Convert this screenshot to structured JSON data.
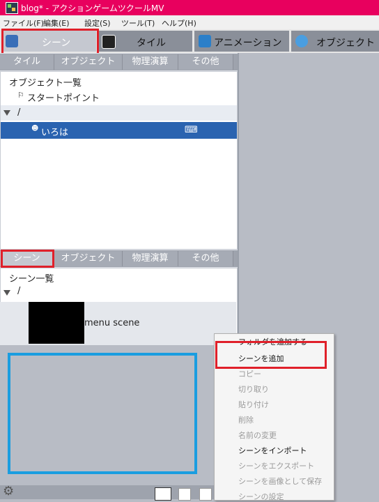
{
  "title_bar": {
    "title": "blog* - アクションゲームツクールMV"
  },
  "menubar": {
    "items": [
      "ファイル(F)",
      "編集(E)",
      "設定(S)",
      "ツール(T)",
      "ヘルプ(H)"
    ]
  },
  "main_tabs": [
    {
      "label": "シーン",
      "active": true
    },
    {
      "label": "タイル"
    },
    {
      "label": "アニメーション"
    },
    {
      "label": "オブジェクト"
    }
  ],
  "top_subtabs": [
    "タイル",
    "オブジェクト",
    "物理演算",
    "その他"
  ],
  "object_list": {
    "header": "オブジェクト一覧",
    "start_point": "スタートポイント",
    "folder": "/",
    "selected_item": "いろは"
  },
  "bottom_subtabs": [
    "シーン",
    "オブジェクト",
    "物理演算",
    "その他"
  ],
  "scene_list": {
    "header": "シーン一覧",
    "folder": "/",
    "scene_name": "menu scene"
  },
  "context_menu": {
    "items": [
      {
        "label": "フォルダを追加する",
        "enabled": true
      },
      {
        "label": "シーンを追加",
        "enabled": true
      },
      {
        "label": "コピー",
        "enabled": false
      },
      {
        "label": "切り取り",
        "enabled": false
      },
      {
        "label": "貼り付け",
        "enabled": false
      },
      {
        "label": "削除",
        "enabled": false
      },
      {
        "label": "名前の変更",
        "enabled": false
      },
      {
        "label": "シーンをインポート",
        "enabled": true
      },
      {
        "label": "シーンをエクスポート",
        "enabled": false
      },
      {
        "label": "シーンを画像として保存",
        "enabled": false
      },
      {
        "label": "シーンの設定",
        "enabled": false
      }
    ]
  },
  "colors": {
    "titlebar": "#e8005e",
    "selection": "#2a63b0",
    "highlight_red": "#e0202a",
    "highlight_blue": "#1a9de0"
  }
}
